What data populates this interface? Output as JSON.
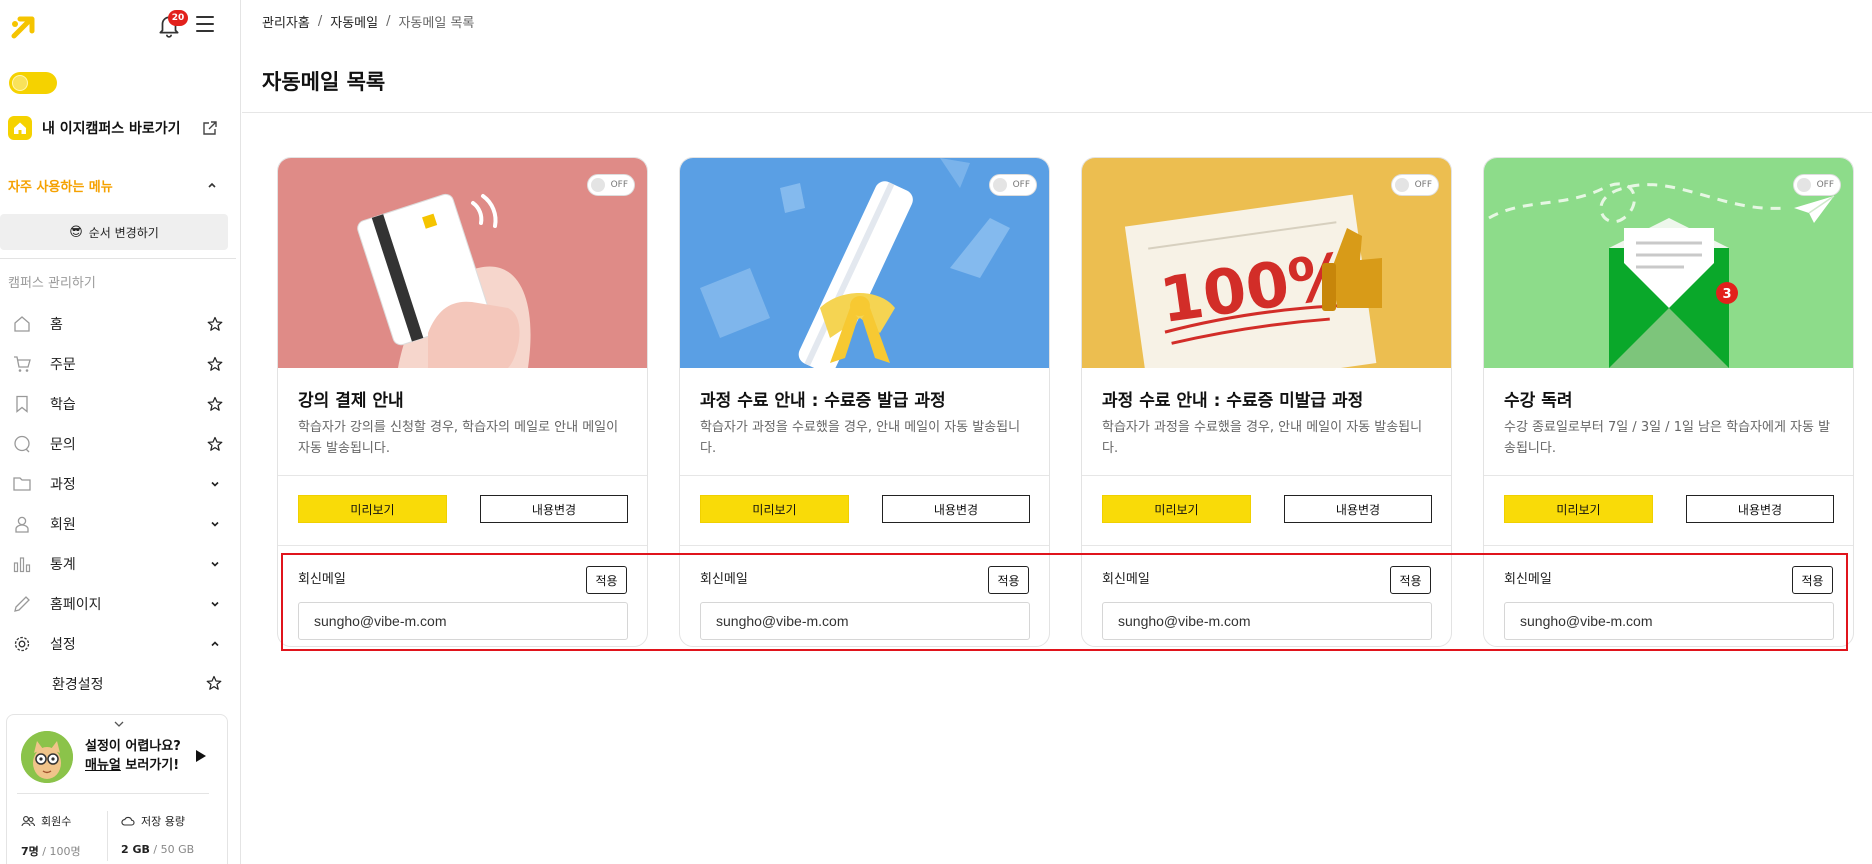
{
  "sidebar": {
    "notification_count": "20",
    "campus_link_label": "내 이지캠퍼스 바로가기",
    "favorites_label": "자주 사용하는 메뉴",
    "order_change_emoji": "😎",
    "order_change_label": "순서 변경하기",
    "campus_manage_label": "캠퍼스 관리하기",
    "nav": [
      {
        "label": "홈",
        "icon": "home-icon",
        "right": "star"
      },
      {
        "label": "주문",
        "icon": "cart-icon",
        "right": "star"
      },
      {
        "label": "학습",
        "icon": "bookmark-icon",
        "right": "star"
      },
      {
        "label": "문의",
        "icon": "chat-icon",
        "right": "star"
      },
      {
        "label": "과정",
        "icon": "folder-icon",
        "right": "chevron-down"
      },
      {
        "label": "회원",
        "icon": "user-icon",
        "right": "chevron-down"
      },
      {
        "label": "통계",
        "icon": "chart-icon",
        "right": "chevron-down"
      },
      {
        "label": "홈페이지",
        "icon": "pencil-icon",
        "right": "chevron-down"
      },
      {
        "label": "설정",
        "icon": "gear-icon",
        "right": "chevron-up"
      }
    ],
    "sub_nav": [
      {
        "label": "환경설정",
        "right": "star"
      }
    ],
    "help": {
      "line1": "설정이 어렵나요?",
      "line2_underlined": "매뉴얼",
      "line2_rest": " 보러가기!"
    },
    "stats": {
      "members_label": "회원수",
      "members_value": "7명",
      "members_total": "100명",
      "storage_label": "저장 용량",
      "storage_value": "2 GB",
      "storage_total": "50 GB"
    }
  },
  "breadcrumb": [
    "관리자홈",
    "자동메일",
    "자동메일 목록"
  ],
  "page_title": "자동메일 목록",
  "cards": [
    {
      "title": "강의 결제 안내",
      "description": "학습자가 강의를 신청할 경우, 학습자의 메일로 안내 메일이 자동 발송됩니다.",
      "toggle": "OFF",
      "preview_label": "미리보기",
      "edit_label": "내용변경",
      "reply_label": "회신메일",
      "apply_label": "적용",
      "reply_email": "sungho@vibe-m.com",
      "bg_color": "#df8b87"
    },
    {
      "title": "과정 수료 안내 : 수료증 발급 과정",
      "description": "학습자가 과정을 수료했을 경우, 안내 메일이 자동 발송됩니다.",
      "toggle": "OFF",
      "preview_label": "미리보기",
      "edit_label": "내용변경",
      "reply_label": "회신메일",
      "apply_label": "적용",
      "reply_email": "sungho@vibe-m.com",
      "bg_color": "#5a9fe4"
    },
    {
      "title": "과정 수료 안내 : 수료증 미발급 과정",
      "description": "학습자가 과정을 수료했을 경우, 안내 메일이 자동 발송됩니다.",
      "toggle": "OFF",
      "preview_label": "미리보기",
      "edit_label": "내용변경",
      "reply_label": "회신메일",
      "apply_label": "적용",
      "reply_email": "sungho@vibe-m.com",
      "bg_color": "#e8b94a",
      "illustration_text": "100%"
    },
    {
      "title": "수강 독려",
      "description": "수강 종료일로부터 7일 / 3일 / 1일 남은 학습자에게 자동 발송됩니다.",
      "toggle": "OFF",
      "preview_label": "미리보기",
      "edit_label": "내용변경",
      "reply_label": "회신메일",
      "apply_label": "적용",
      "reply_email": "sungho@vibe-m.com",
      "bg_color": "#8ddc8a",
      "illustration_badge": "3"
    }
  ],
  "colors": {
    "accent_yellow": "#f9db08",
    "highlight_red": "#e0141c",
    "favorites_orange": "#f5a100"
  }
}
